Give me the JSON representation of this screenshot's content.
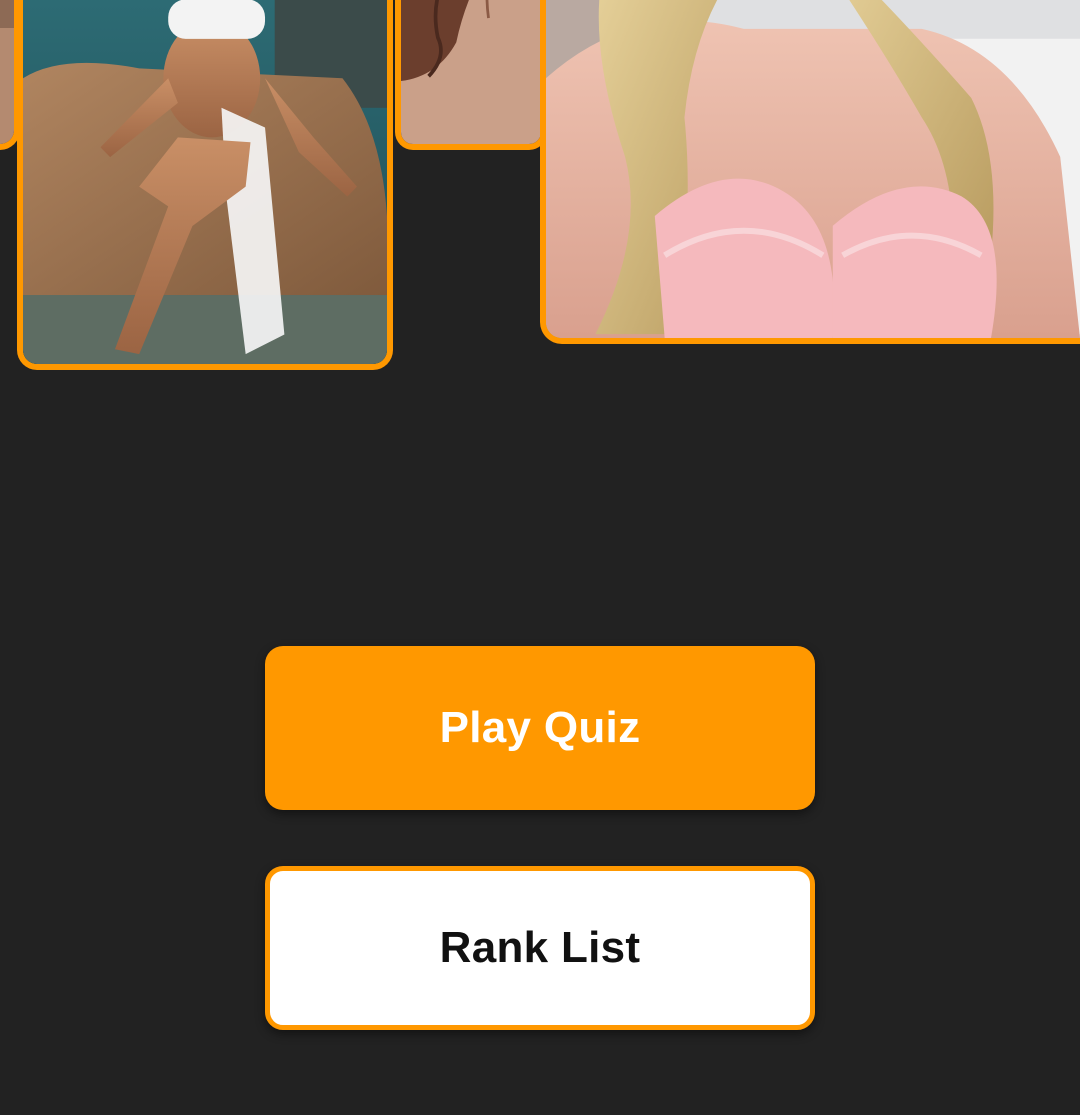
{
  "theme": {
    "background": "#222222",
    "accent": "#ff9800",
    "button_primary_text": "#ffffff",
    "button_secondary_bg": "#ffffff",
    "button_secondary_text": "#111111"
  },
  "gallery": {
    "photos": [
      {
        "description": "partially visible photo at left edge"
      },
      {
        "description": "woman in white bikini sitting on rock by pool"
      },
      {
        "description": "close-up crop with hair, partially visible"
      },
      {
        "description": "woman with blonde hair in pink lace lingerie"
      }
    ]
  },
  "actions": {
    "play_quiz_label": "Play Quiz",
    "rank_list_label": "Rank List"
  }
}
